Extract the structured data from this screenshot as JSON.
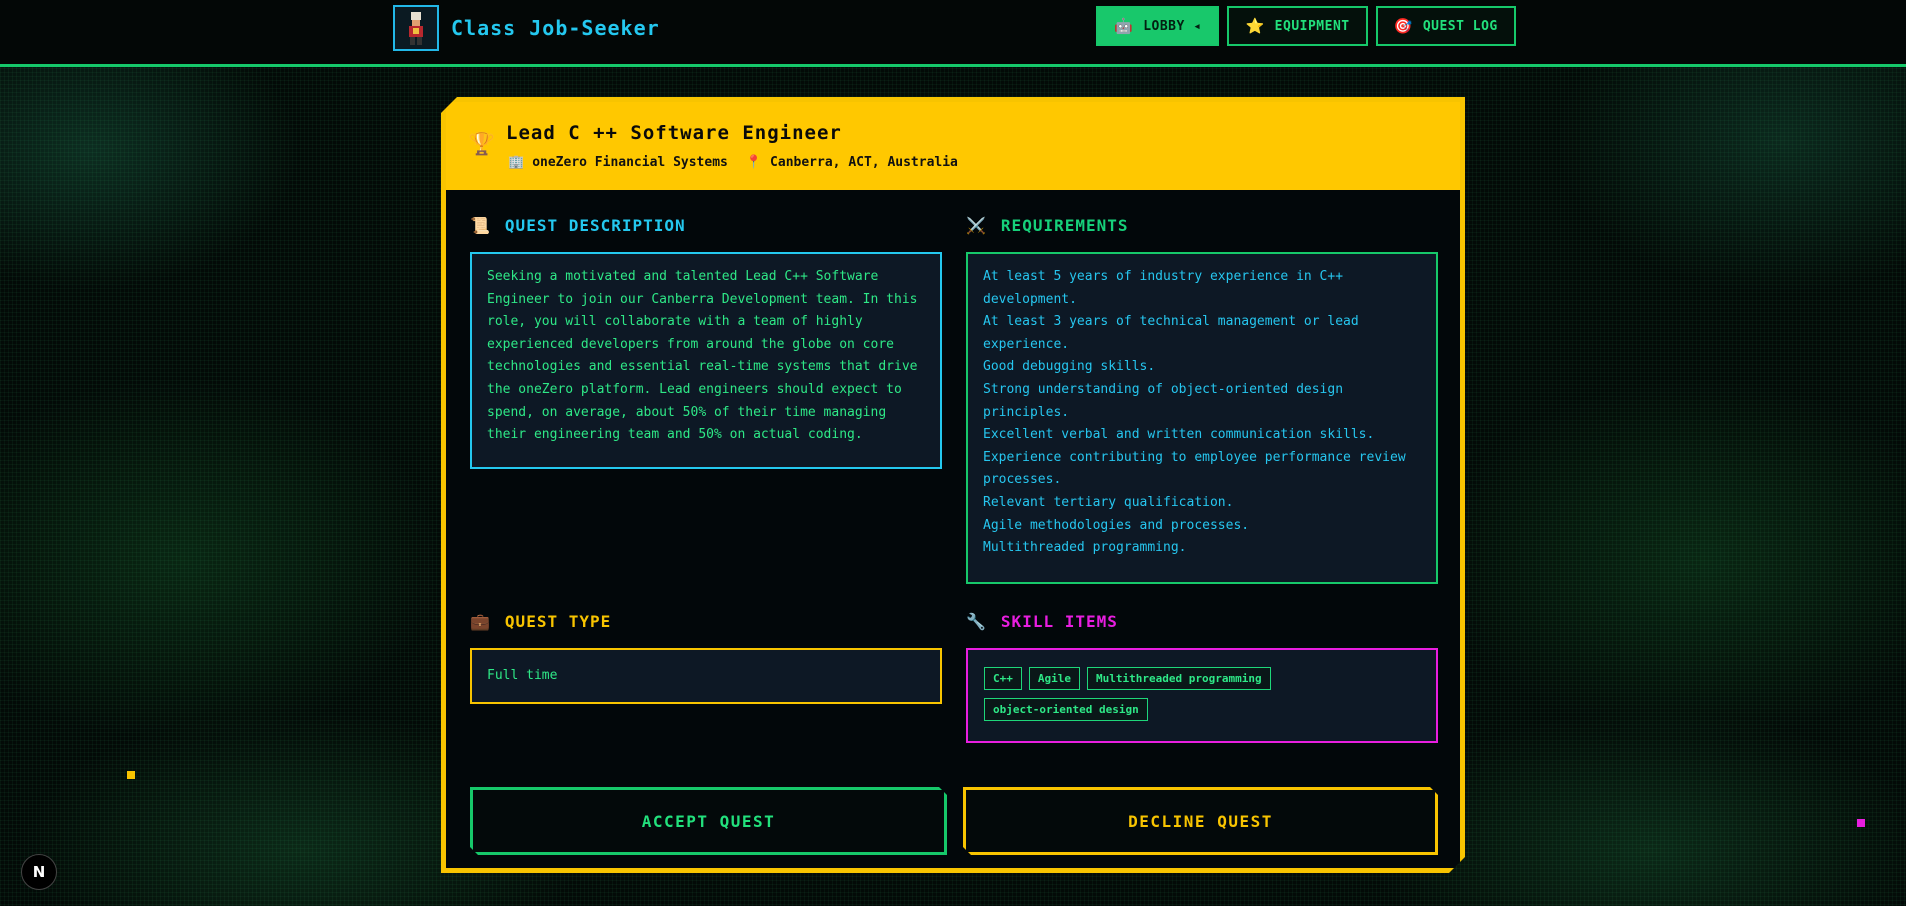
{
  "header": {
    "app_title": "Class Job-Seeker",
    "nav": [
      {
        "label": "LOBBY ◂",
        "icon": "robot-icon",
        "active": true
      },
      {
        "label": "EQUIPMENT",
        "icon": "star-icon",
        "active": false
      },
      {
        "label": "QUEST LOG",
        "icon": "target-icon",
        "active": false
      }
    ]
  },
  "job": {
    "title": "Lead C ++ Software Engineer",
    "company": "oneZero Financial Systems",
    "location": "Canberra, ACT, Australia"
  },
  "sections": {
    "description_title": "QUEST DESCRIPTION",
    "description_text": "Seeking a motivated and talented Lead C++ Software Engineer to join our Canberra Development team. In this role, you will collaborate with a team of highly experienced developers from around the globe on core technologies and essential real-time systems that drive the oneZero platform. Lead engineers should expect to spend, on average, about 50% of their time managing their engineering team and 50% on actual coding.",
    "requirements_title": "REQUIREMENTS",
    "requirements": [
      "At least 5 years of industry experience in C++ development.",
      "At least 3 years of technical management or lead experience.",
      "Good debugging skills.",
      "Strong understanding of object-oriented design principles.",
      "Excellent verbal and written communication skills.",
      "Experience contributing to employee performance review processes.",
      "Relevant tertiary qualification.",
      "Agile methodologies and processes.",
      "Multithreaded programming."
    ],
    "type_title": "QUEST TYPE",
    "type_value": "Full time",
    "skills_title": "SKILL ITEMS",
    "skills": [
      "C++",
      "Agile",
      "Multithreaded programming",
      "object-oriented design"
    ]
  },
  "actions": {
    "accept": "ACCEPT QUEST",
    "decline": "DECLINE QUEST"
  },
  "badge": "N",
  "colors": {
    "green": "#16c86a",
    "cyan": "#24c8ef",
    "yellow": "#ffc800",
    "magenta": "#e81ee0"
  }
}
